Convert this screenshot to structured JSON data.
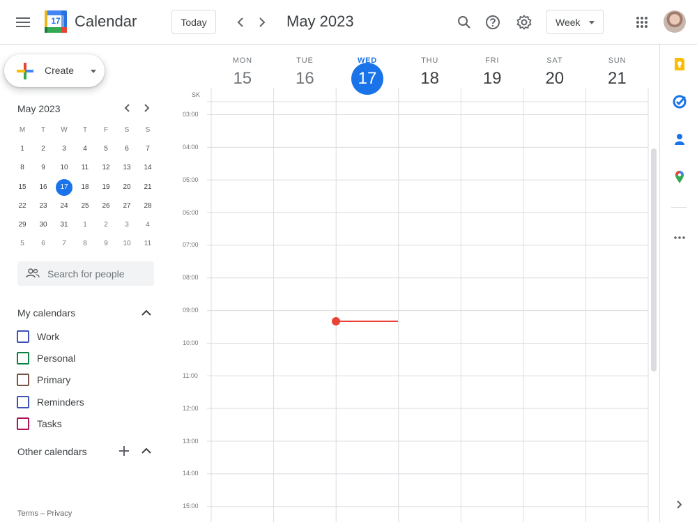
{
  "header": {
    "app_title": "Calendar",
    "logo_number": "17",
    "today_label": "Today",
    "current_range": "May 2023",
    "view_label": "Week"
  },
  "sidebar": {
    "create_label": "Create",
    "mini_calendar": {
      "title": "May 2023",
      "weekday_headers": [
        "M",
        "T",
        "W",
        "T",
        "F",
        "S",
        "S"
      ],
      "weeks": [
        [
          "1",
          "2",
          "3",
          "4",
          "5",
          "6",
          "7"
        ],
        [
          "8",
          "9",
          "10",
          "11",
          "12",
          "13",
          "14"
        ],
        [
          "15",
          "16",
          "17",
          "18",
          "19",
          "20",
          "21"
        ],
        [
          "22",
          "23",
          "24",
          "25",
          "26",
          "27",
          "28"
        ],
        [
          "29",
          "30",
          "31",
          "1",
          "2",
          "3",
          "4"
        ],
        [
          "5",
          "6",
          "7",
          "8",
          "9",
          "10",
          "11"
        ]
      ],
      "today": "17"
    },
    "search_people_placeholder": "Search for people",
    "my_calendars_title": "My calendars",
    "my_calendars": [
      {
        "name": "Work",
        "color": "#3f51b5"
      },
      {
        "name": "Personal",
        "color": "#0b8043"
      },
      {
        "name": "Primary",
        "color": "#795548"
      },
      {
        "name": "Reminders",
        "color": "#3f51b5"
      },
      {
        "name": "Tasks",
        "color": "#ad1457"
      }
    ],
    "other_calendars_title": "Other calendars",
    "footer_terms": "Terms",
    "footer_sep": "–",
    "footer_privacy": "Privacy"
  },
  "week": {
    "timezone_label": "SK",
    "days": [
      {
        "dow": "MON",
        "num": "15",
        "state": "past"
      },
      {
        "dow": "TUE",
        "num": "16",
        "state": "past"
      },
      {
        "dow": "WED",
        "num": "17",
        "state": "today"
      },
      {
        "dow": "THU",
        "num": "18",
        "state": "future"
      },
      {
        "dow": "FRI",
        "num": "19",
        "state": "future"
      },
      {
        "dow": "SAT",
        "num": "20",
        "state": "future"
      },
      {
        "dow": "SUN",
        "num": "21",
        "state": "future"
      }
    ],
    "hours": [
      "03:00",
      "04:00",
      "05:00",
      "06:00",
      "07:00",
      "08:00",
      "09:00",
      "10:00",
      "11:00",
      "12:00",
      "13:00",
      "14:00",
      "15:00"
    ]
  },
  "colors": {
    "accent": "#1a73e8",
    "now_indicator": "#ea4335"
  },
  "right_panel": {
    "icons": [
      "keep-icon",
      "tasks-icon",
      "contacts-icon",
      "maps-icon",
      "more-icon",
      "expand-chevron-icon"
    ]
  }
}
